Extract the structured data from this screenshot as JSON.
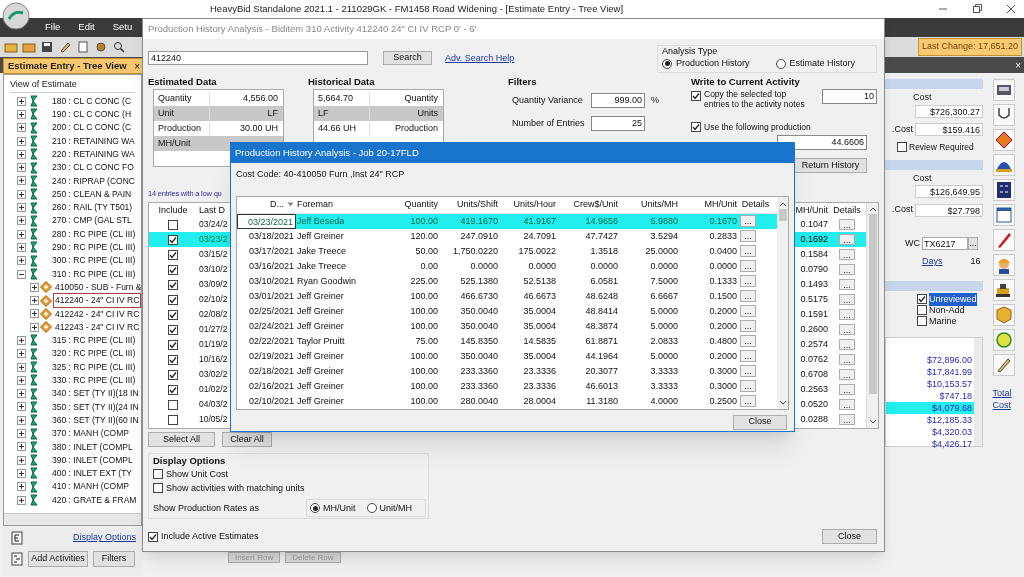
{
  "app": {
    "title": "HeavyBid Standalone 2021.1 - 211029GK - FM1458 Road Widening  - [Estimate Entry - Tree View]",
    "menu": [
      "File",
      "Edit",
      "Setu"
    ],
    "last_change": "Last Change: 17,651.20",
    "tab": {
      "label": "Estimate Entry - Tree View",
      "close": "×"
    }
  },
  "tree": {
    "header": "View of Estimate",
    "items": [
      {
        "label": "180 : CL C CONC (C",
        "expanded": false,
        "selected": false
      },
      {
        "label": "190 : CL C CONC (H",
        "expanded": false,
        "selected": false
      },
      {
        "label": "200 : CL C CONC (C",
        "expanded": false,
        "selected": false
      },
      {
        "label": "210 : RETAINING WA",
        "expanded": false,
        "selected": false
      },
      {
        "label": "220 : RETAINING WA",
        "expanded": false,
        "selected": false
      },
      {
        "label": "230 : CL C CONC FO",
        "expanded": false,
        "selected": false
      },
      {
        "label": "240 : RIPRAP (CONC",
        "expanded": false,
        "selected": false
      },
      {
        "label": "250 : CLEAN & PAIN",
        "expanded": false,
        "selected": false
      },
      {
        "label": "260 : RAIL (TY T501)",
        "expanded": false,
        "selected": false
      },
      {
        "label": "270 : CMP (GAL STL",
        "expanded": false,
        "selected": false
      },
      {
        "label": "280 : RC PIPE (CL III)",
        "expanded": false,
        "selected": false
      },
      {
        "label": "290 : RC PIPE (CL III)",
        "expanded": false,
        "selected": false
      },
      {
        "label": "300 : RC PIPE (CL III)",
        "expanded": false,
        "selected": false
      },
      {
        "label": "310 : RC PIPE (CL III)",
        "expanded": true,
        "selected": false,
        "children": [
          {
            "label": "410050 - SUB - Furn &",
            "expanded": false,
            "selected": false
          },
          {
            "label": "412240 - 24\" CI IV RC",
            "expanded": false,
            "selected": true
          },
          {
            "label": "412242 - 24\" CI IV RC",
            "expanded": false,
            "selected": false
          },
          {
            "label": "412243 - 24\" CI IV RC",
            "expanded": false,
            "selected": false
          }
        ]
      },
      {
        "label": "315 : RC PIPE (CL III)",
        "expanded": false,
        "selected": false
      },
      {
        "label": "320 : RC PIPE (CL III)",
        "expanded": false,
        "selected": false
      },
      {
        "label": "325 : RC PIPE (CL III)",
        "expanded": false,
        "selected": false
      },
      {
        "label": "330 : RC PIPE (CL III)",
        "expanded": false,
        "selected": false
      },
      {
        "label": "340 : SET (TY II)(18 IN",
        "expanded": false,
        "selected": false
      },
      {
        "label": "350 : SET (TY II)(24 IN",
        "expanded": false,
        "selected": false
      },
      {
        "label": "360 : SET (TY II)(60 IN",
        "expanded": false,
        "selected": false
      },
      {
        "label": "370 : MANH (COMP",
        "expanded": false,
        "selected": false
      },
      {
        "label": "380 : INLET (COMPL",
        "expanded": false,
        "selected": false
      },
      {
        "label": "390 : INLET (COMPL",
        "expanded": false,
        "selected": false
      },
      {
        "label": "400 : INLET EXT (TY",
        "expanded": false,
        "selected": false
      },
      {
        "label": "410 : MANH (COMP",
        "expanded": false,
        "selected": false
      },
      {
        "label": "420 : GRATE & FRAM",
        "expanded": false,
        "selected": false
      }
    ],
    "display_options": "Display Options",
    "buttons": [
      "Add Activities",
      "Filters"
    ]
  },
  "background_buttons": [
    "Insert Row",
    "Delete Row"
  ],
  "right_panel": {
    "close": "×",
    "section_1": {
      "cost_label": "Cost",
      "cost": "$726,300.27",
      "unit_cost_label": ".Cost",
      "unit_cost": "$159.416"
    },
    "review_required": {
      "label": "Review Required",
      "checked": false
    },
    "section_2": {
      "cost_label": "Cost",
      "cost": "$126,649.95",
      "unit_cost_label": ".Cost",
      "unit_cost": "$27.798"
    },
    "wc_label": "WC",
    "wc": "TX6217",
    "wc_button": "...",
    "days_label": "Days",
    "days": "16",
    "flags": [
      {
        "label": "Unreviewed",
        "checked": true
      },
      {
        "label": "Non-Add",
        "checked": false
      },
      {
        "label": "Marine",
        "checked": false
      }
    ],
    "amounts": [
      {
        "value": "$72,896.00",
        "selected": false
      },
      {
        "value": "$17,841.99",
        "selected": false
      },
      {
        "value": "$10,153.57",
        "selected": false
      },
      {
        "value": "$747.18",
        "selected": false
      },
      {
        "value": "$4,079.68",
        "selected": true
      },
      {
        "value": "$12,185.33",
        "selected": false
      },
      {
        "value": "$4,320.03",
        "selected": false
      },
      {
        "value": "$4,426.17",
        "selected": false
      }
    ],
    "total_cost": "Total Cost"
  },
  "history_dialog": {
    "title": "Production History Analysis - Biditem 310 Activity 412240 24\" CI IV RCP  0' - 6'",
    "search": {
      "value": "412240",
      "button": "Search",
      "help_link": "Adv. Search Help"
    },
    "analysis_type": {
      "label": "Analysis Type",
      "options": [
        {
          "label": "Production History",
          "selected": true
        },
        {
          "label": "Estimate History",
          "selected": false
        }
      ]
    },
    "estimated_data": {
      "title": "Estimated Data",
      "rows": [
        {
          "label": "Quantity",
          "value": "4,556.00"
        },
        {
          "label": "Unit",
          "value": "LF"
        },
        {
          "label": "Production",
          "value": "30.00 UH"
        },
        {
          "label": "MH/Unit"
        }
      ]
    },
    "historical_data": {
      "title": "Historical Data",
      "rows": [
        {
          "value": "5,664.70",
          "label": "Quantity"
        },
        {
          "value": "LF",
          "label": "Units"
        },
        {
          "value": "44.66 UH",
          "label": "Production"
        }
      ]
    },
    "filters": {
      "title": "Filters",
      "fields": [
        {
          "kind": "text",
          "label": "Quantity Variance",
          "value": "999.00",
          "suffix": "%"
        },
        {
          "kind": "text",
          "label": "Number of Entries",
          "value": "25"
        }
      ]
    },
    "write_to_activity": {
      "title": "Write to Current Activity",
      "copy_notes": {
        "label": "Copy the selected top entries to the activity notes",
        "checked": true,
        "value": "10"
      },
      "use_production": {
        "label": "Use the following production",
        "checked": true,
        "value": "44.6606"
      },
      "return_button": "Return History"
    },
    "entries_note": "14 entries with a low qu",
    "table": {
      "columns": [
        "Include",
        "Last D",
        "MH/Unit",
        "Details"
      ],
      "rows": [
        {
          "checked": false,
          "date": "03/24/2",
          "mh_unit": "0.1047",
          "details": "...",
          "selected": false
        },
        {
          "checked": true,
          "date": "03/23/2",
          "mh_unit": "0.1692",
          "details": "...",
          "selected": true
        },
        {
          "checked": true,
          "date": "03/15/2",
          "mh_unit": "0.1584",
          "details": "...",
          "selected": false
        },
        {
          "checked": true,
          "date": "03/10/2",
          "mh_unit": "0.0790",
          "details": "...",
          "selected": false
        },
        {
          "checked": true,
          "date": "03/09/2",
          "mh_unit": "0.1493",
          "details": "...",
          "selected": false
        },
        {
          "checked": true,
          "date": "02/10/2",
          "mh_unit": "0.5175",
          "details": "...",
          "selected": false
        },
        {
          "checked": true,
          "date": "02/08/2",
          "mh_unit": "0.1591",
          "details": "...",
          "selected": false
        },
        {
          "checked": true,
          "date": "01/27/2",
          "mh_unit": "0.2600",
          "details": "...",
          "selected": false
        },
        {
          "checked": true,
          "date": "01/19/2",
          "mh_unit": "0.2574",
          "details": "...",
          "selected": false
        },
        {
          "checked": true,
          "date": "10/16/2",
          "mh_unit": "0.0762",
          "details": "...",
          "selected": false
        },
        {
          "checked": true,
          "date": "03/02/2",
          "mh_unit": "0.6708",
          "details": "...",
          "selected": false
        },
        {
          "checked": true,
          "date": "01/02/2",
          "mh_unit": "0.2563",
          "details": "...",
          "selected": false
        },
        {
          "checked": false,
          "date": "04/03/2",
          "mh_unit": "0.0520",
          "details": "...",
          "selected": false
        },
        {
          "checked": false,
          "date": "10/05/2",
          "mh_unit": "0.0288",
          "details": "...",
          "selected": false
        }
      ]
    },
    "buttons": [
      "Select All",
      "Clear All"
    ],
    "display_options": {
      "title": "Display Options",
      "checks": [
        {
          "label": "Show Unit Cost",
          "checked": false
        },
        {
          "label": "Show activities with matching units",
          "checked": false
        }
      ],
      "rates_label": "Show Production Rates as",
      "rates": [
        {
          "label": "MH/Unit",
          "selected": true
        },
        {
          "label": "Unit/MH",
          "selected": false
        }
      ]
    },
    "include_active": {
      "label": "Include Active Estimates",
      "checked": true
    },
    "close": "Close"
  },
  "job_dialog": {
    "title": "Production History Analysis - Job 20-17FLD",
    "cost_code": "Cost Code: 40-410050 Furn ,Inst 24\" RCP",
    "columns": [
      "D...",
      "Foreman",
      "Quantity",
      "Units/Shift",
      "Units/Hour",
      "Crew$/Unit",
      "Units/MH",
      "MH/Unit",
      "Details"
    ],
    "rows": [
      {
        "cells": [
          "03/23/2021",
          "Jeff Beseda",
          "100.00",
          "419.1670",
          "41.9167",
          "14.9656",
          "5.9880",
          "0.1670",
          "..."
        ],
        "selected": true
      },
      {
        "cells": [
          "03/18/2021",
          "Jeff Greiner",
          "120.00",
          "247.0910",
          "24.7091",
          "47.7427",
          "3.5294",
          "0.2833",
          "..."
        ],
        "selected": false
      },
      {
        "cells": [
          "03/17/2021",
          "Jake Treece",
          "50.00",
          "1,750.0220",
          "175.0022",
          "1.3518",
          "25.0000",
          "0.0400",
          "..."
        ],
        "selected": false
      },
      {
        "cells": [
          "03/16/2021",
          "Jake Treece",
          "0.00",
          "0.0000",
          "0.0000",
          "0.0000",
          "0.0000",
          "0.0000",
          "..."
        ],
        "selected": false
      },
      {
        "cells": [
          "03/10/2021",
          "Ryan Goodwin",
          "225.00",
          "525.1380",
          "52.5138",
          "6.0581",
          "7.5000",
          "0.1333",
          "..."
        ],
        "selected": false
      },
      {
        "cells": [
          "03/01/2021",
          "Jeff Greiner",
          "100.00",
          "466.6730",
          "46.6673",
          "48.6248",
          "6.6667",
          "0.1500",
          "..."
        ],
        "selected": false
      },
      {
        "cells": [
          "02/25/2021",
          "Jeff Greiner",
          "100.00",
          "350.0040",
          "35.0004",
          "48.8414",
          "5.0000",
          "0.2000",
          "..."
        ],
        "selected": false
      },
      {
        "cells": [
          "02/24/2021",
          "Jeff Greiner",
          "100.00",
          "350.0040",
          "35.0004",
          "48.3874",
          "5.0000",
          "0.2000",
          "..."
        ],
        "selected": false
      },
      {
        "cells": [
          "02/22/2021",
          "Taylor Pruitt",
          "75.00",
          "145.8350",
          "14.5835",
          "61.8871",
          "2.0833",
          "0.4800",
          "..."
        ],
        "selected": false
      },
      {
        "cells": [
          "02/19/2021",
          "Jeff Greiner",
          "100.00",
          "350.0040",
          "35.0004",
          "44.1964",
          "5.0000",
          "0.2000",
          "..."
        ],
        "selected": false
      },
      {
        "cells": [
          "02/18/2021",
          "Jeff Greiner",
          "100.00",
          "233.3360",
          "23.3336",
          "20.3077",
          "3.3333",
          "0.3000",
          "..."
        ],
        "selected": false
      },
      {
        "cells": [
          "02/16/2021",
          "Jeff Greiner",
          "100.00",
          "233.3360",
          "23.3336",
          "46.6013",
          "3.3333",
          "0.3000",
          "..."
        ],
        "selected": false
      },
      {
        "cells": [
          "02/10/2021",
          "Jeff Greiner",
          "100.00",
          "280.0040",
          "28.0004",
          "11.3180",
          "4.0000",
          "0.2500",
          "..."
        ],
        "selected": false
      }
    ],
    "close": "Close"
  }
}
